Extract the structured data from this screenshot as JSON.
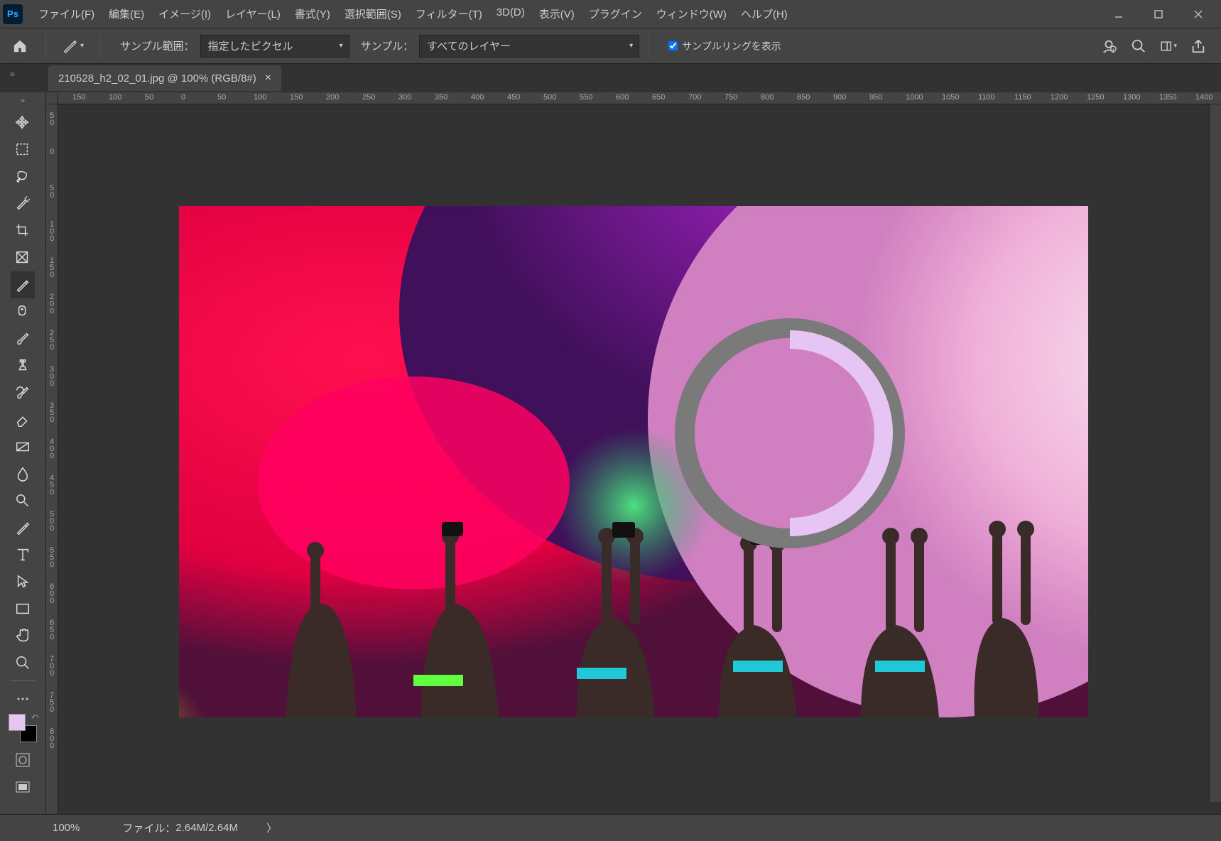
{
  "menu": [
    "ファイル(F)",
    "編集(E)",
    "イメージ(I)",
    "レイヤー(L)",
    "書式(Y)",
    "選択範囲(S)",
    "フィルター(T)",
    "3D(D)",
    "表示(V)",
    "プラグイン",
    "ウィンドウ(W)",
    "ヘルプ(H)"
  ],
  "options": {
    "sample_range_label": "サンプル範囲：",
    "sample_range_value": "指定したピクセル",
    "sample_label": "サンプル：",
    "sample_value": "すべてのレイヤー",
    "show_ring": "サンプルリングを表示"
  },
  "tab": {
    "title": "210528_h2_02_01.jpg @ 100% (RGB/8#)"
  },
  "tools": [
    "move",
    "marquee",
    "lasso",
    "wand",
    "crop",
    "frame",
    "eyedropper",
    "heal",
    "brush",
    "stamp",
    "history-brush",
    "eraser",
    "gradient",
    "blur",
    "dodge",
    "pen",
    "type",
    "path-select",
    "rectangle",
    "hand",
    "zoom"
  ],
  "swatch_fg": "#e6c4f3",
  "ruler_h": [
    "150",
    "100",
    "50",
    "0",
    "50",
    "100",
    "150",
    "200",
    "250",
    "300",
    "350",
    "400",
    "450",
    "500",
    "550",
    "600",
    "650",
    "700",
    "750",
    "800",
    "850",
    "900",
    "950",
    "1000",
    "1050",
    "1100",
    "1150",
    "1200",
    "1250",
    "1300",
    "1350",
    "1400"
  ],
  "ruler_v": [
    "50",
    "0",
    "50",
    "100",
    "150",
    "200",
    "250",
    "300",
    "350",
    "400",
    "450",
    "500",
    "550",
    "600",
    "650",
    "700",
    "750",
    "800"
  ],
  "status": {
    "zoom": "100%",
    "file_label": "ファイル：",
    "file_size": "2.64M/2.64M"
  }
}
